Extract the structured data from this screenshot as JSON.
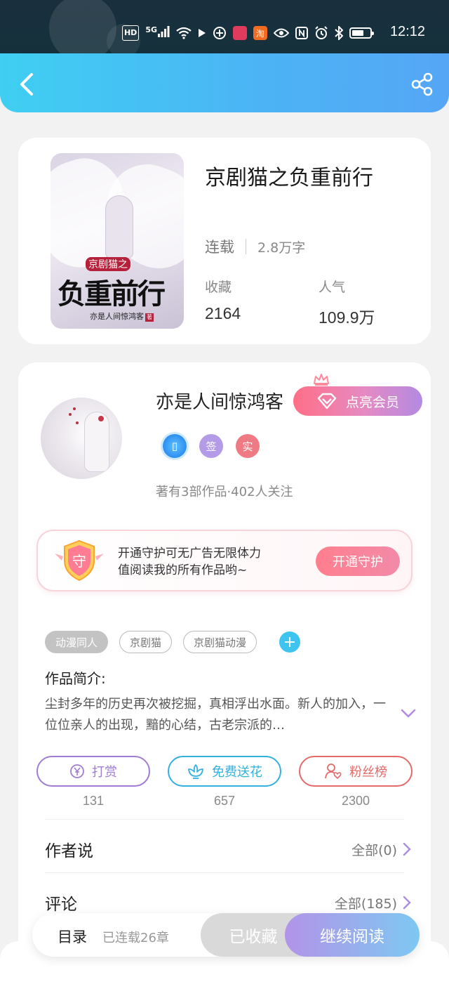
{
  "status_bar": {
    "time": "12:12",
    "hd_label": "HD",
    "network_label": "5G",
    "app_taobao_label": "淘",
    "icons": [
      "hd-icon",
      "5g-signal-icon",
      "wifi-icon",
      "play-icon",
      "app-icon",
      "app-icon",
      "taobao-icon",
      "eye-icon",
      "nfc-icon",
      "alarm-icon",
      "bluetooth-icon",
      "battery-icon"
    ]
  },
  "header": {
    "back_icon": "chevron-left-icon",
    "share_icon": "share-icon"
  },
  "book": {
    "title": "京剧猫之负重前行",
    "status": "连载",
    "word_count": "2.8万字",
    "favorites_label": "收藏",
    "favorites_value": "2164",
    "popularity_label": "人气",
    "popularity_value": "109.9万",
    "cover": {
      "subtitle": "京剧猫之",
      "main_title": "负重前行",
      "author_line": "亦是人间惊鸿客",
      "seal": "著"
    }
  },
  "author": {
    "name": "亦是人间惊鸿客",
    "vip_button": "点亮会员",
    "badges": {
      "phone": "▯",
      "signed": "签",
      "real": "实"
    },
    "stats": "著有3部作品·402人关注"
  },
  "guard": {
    "icon_char": "守",
    "line1": "开通守护可无广告无限体力",
    "line2": "值阅读我的所有作品哟~",
    "button": "开通守护"
  },
  "tags": [
    "动漫同人",
    "京剧猫",
    "京剧猫动漫"
  ],
  "tag_add": "+",
  "intro": {
    "title": "作品简介:",
    "text": "尘封多年的历史再次被挖掘，真相浮出水面。新人的加入，一位位亲人的出现，黯的心结，古老宗派的…"
  },
  "actions": [
    {
      "label": "打赏",
      "count": "131",
      "icon": "coin-icon"
    },
    {
      "label": "免费送花",
      "count": "657",
      "icon": "flower-icon"
    },
    {
      "label": "粉丝榜",
      "count": "2300",
      "icon": "fans-icon"
    }
  ],
  "author_says": {
    "label": "作者说",
    "more": "全部(0)"
  },
  "comments": {
    "label": "评论",
    "more": "全部(185)"
  },
  "bottom_bar": {
    "toc": "目录",
    "chapters": "已连载26章",
    "collected": "已收藏",
    "continue": "继续阅读"
  },
  "colors": {
    "header_start": "#3fcff2",
    "header_end": "#55a6f5",
    "vip_gradient_start": "#ff6f86",
    "vip_gradient_end": "#b38ae3",
    "guard_button": "#ff7f8e",
    "read_button_start": "#b294e8",
    "read_button_end": "#7ec8f2"
  }
}
